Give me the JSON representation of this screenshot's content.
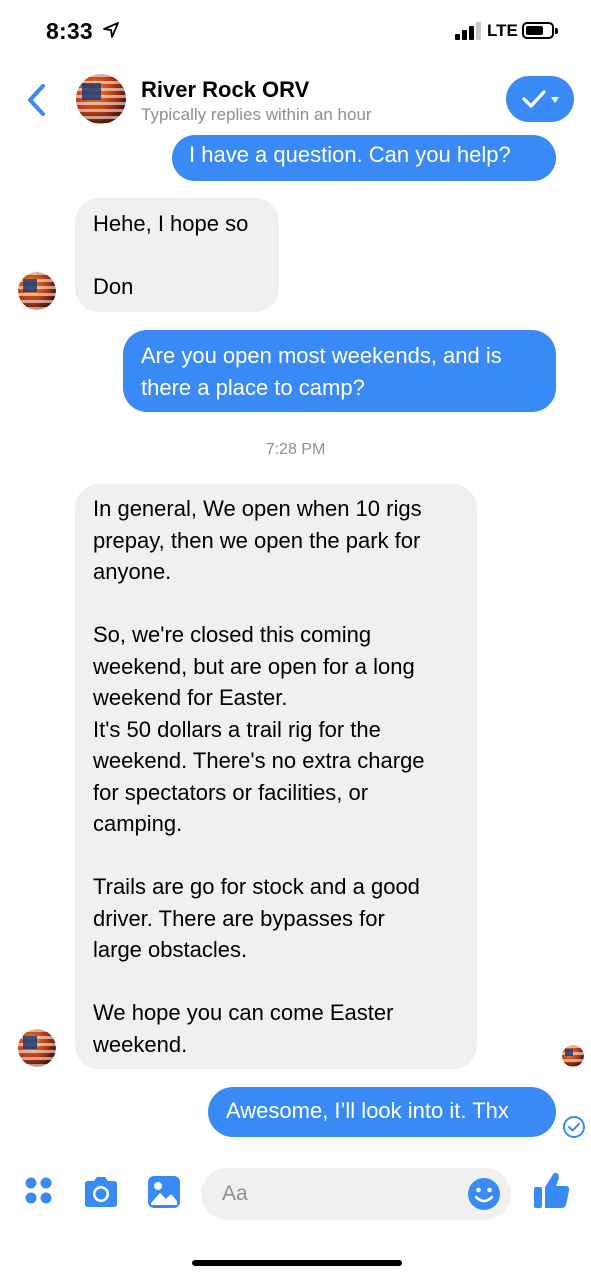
{
  "status_bar": {
    "time": "8:33",
    "network": "LTE"
  },
  "header": {
    "contact_name": "River Rock ORV",
    "subtitle": "Typically replies within an hour"
  },
  "messages": [
    {
      "from": "me",
      "text": "I have a question. Can you help?"
    },
    {
      "from": "them",
      "lines": [
        "Hehe, I hope so",
        "",
        "Don"
      ]
    },
    {
      "from": "me",
      "lines": [
        "Are you open most weekends, and is",
        "there a place to camp?"
      ]
    },
    {
      "from": "them",
      "lines": [
        "In general, We open when 10 rigs",
        "prepay, then we open the park for",
        "anyone.",
        "",
        "So, we're closed this coming",
        "weekend, but are open for a long",
        "weekend for Easter.",
        "It's 50 dollars a trail rig for the",
        "weekend. There's no extra charge",
        "for spectators or facilities, or",
        "camping.",
        "",
        "Trails are go for stock and a good",
        "driver. There are bypasses for",
        "large obstacles.",
        "",
        "We hope you can come Easter",
        "weekend."
      ]
    },
    {
      "from": "me",
      "text": "Awesome, I’ll look into it. Thx"
    }
  ],
  "timestamp": "7:28 PM",
  "composer": {
    "placeholder": "Aa"
  },
  "colors": {
    "accent": "#3a8af5",
    "incoming_bubble": "#f0f0f0",
    "muted_text": "#8e8e93"
  },
  "icons": [
    "location-arrow-icon",
    "signal-icon",
    "battery-icon",
    "back-chevron-icon",
    "checkmark-icon",
    "dropdown-caret-icon",
    "apps-icon",
    "camera-icon",
    "gallery-icon",
    "emoji-icon",
    "thumbs-up-icon",
    "sent-check-icon"
  ]
}
